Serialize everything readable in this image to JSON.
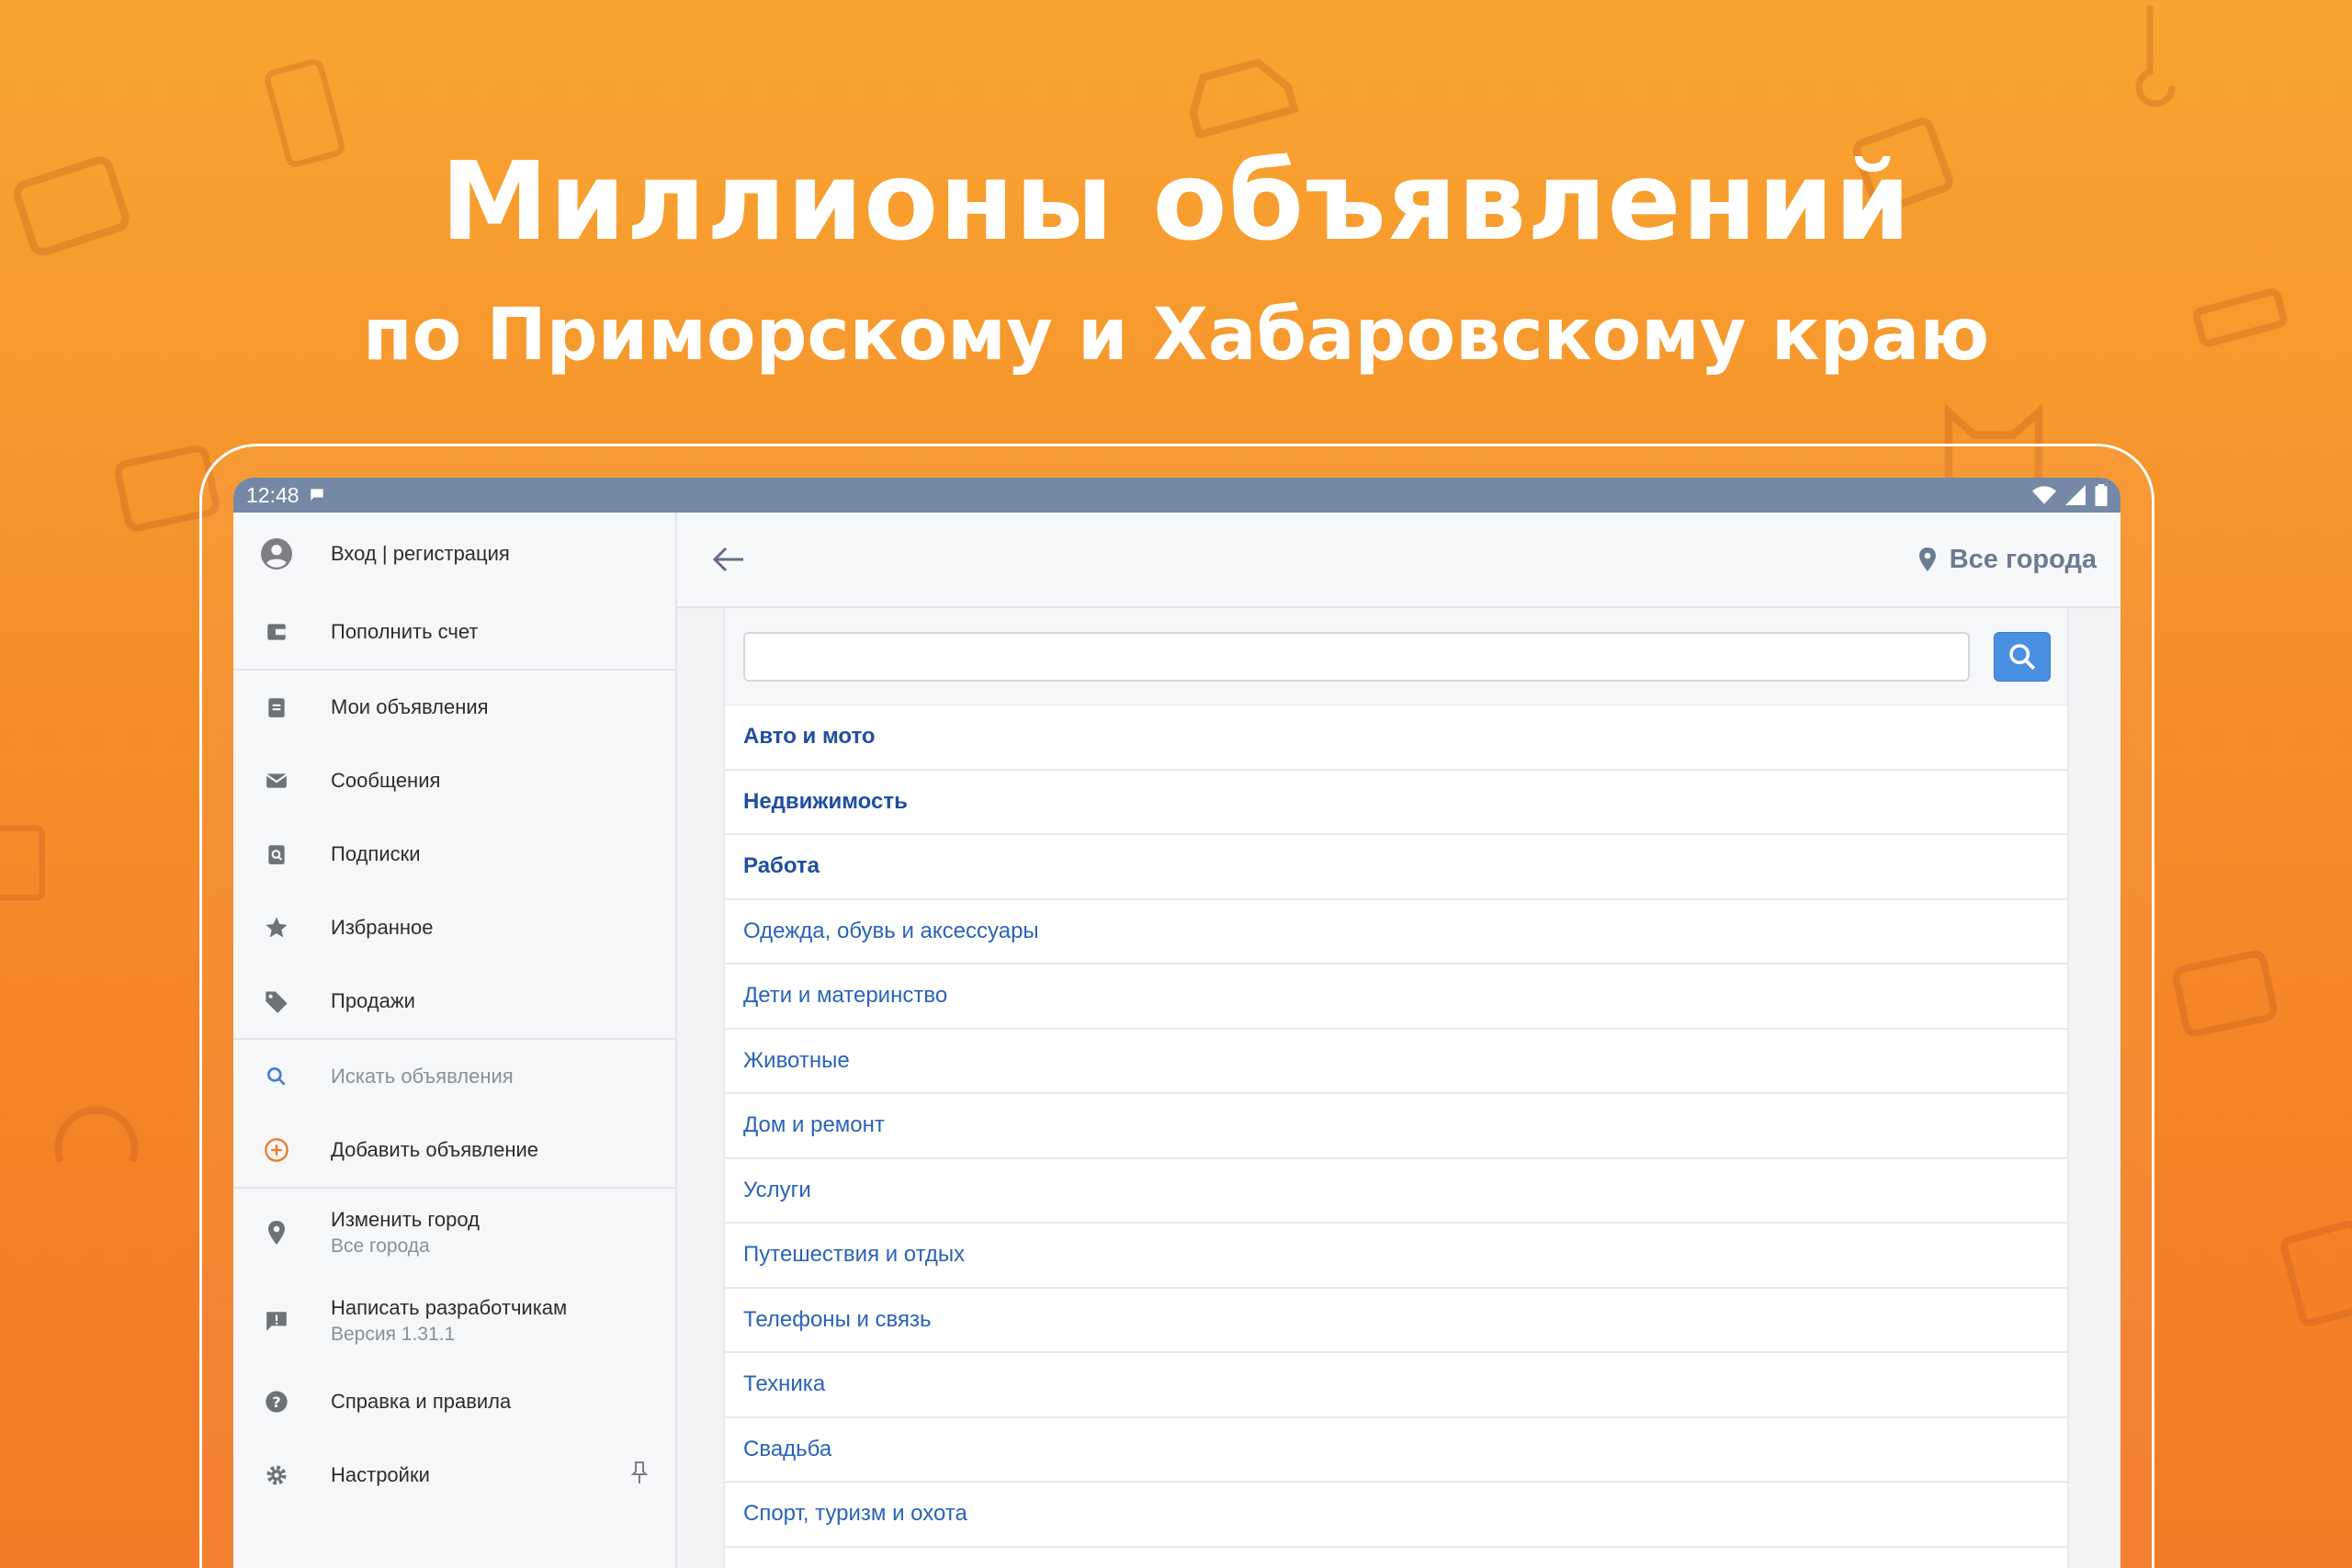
{
  "promo": {
    "headline": "Миллионы объявлений",
    "subheadline": "по Приморскому и Хабаровскому краю"
  },
  "statusbar": {
    "time": "12:48"
  },
  "drawer": {
    "login_label": "Вход | регистрация",
    "topup_label": "Пополнить счет",
    "items": [
      {
        "label": "Мои объявления",
        "icon": "clipboard-icon"
      },
      {
        "label": "Сообщения",
        "icon": "mail-icon"
      },
      {
        "label": "Подписки",
        "icon": "subscription-icon"
      },
      {
        "label": "Избранное",
        "icon": "star-icon"
      },
      {
        "label": "Продажи",
        "icon": "tag-icon"
      }
    ],
    "search_label": "Искать объявления",
    "add_label": "Добавить объявление",
    "change_city_label": "Изменить город",
    "change_city_value": "Все города",
    "write_dev_label": "Написать разработчикам",
    "version": "Версия 1.31.1",
    "help_label": "Справка и правила",
    "settings_label": "Настройки"
  },
  "appbar": {
    "city_label": "Все города"
  },
  "search": {
    "value": "",
    "placeholder": ""
  },
  "categories": [
    {
      "label": "Авто и мото",
      "bold": true
    },
    {
      "label": "Недвижимость",
      "bold": true
    },
    {
      "label": "Работа",
      "bold": true
    },
    {
      "label": "Одежда, обувь и аксессуары",
      "bold": false
    },
    {
      "label": "Дети и материнство",
      "bold": false
    },
    {
      "label": "Животные",
      "bold": false
    },
    {
      "label": "Дом и ремонт",
      "bold": false
    },
    {
      "label": "Услуги",
      "bold": false
    },
    {
      "label": "Путешествия и отдых",
      "bold": false
    },
    {
      "label": "Телефоны и связь",
      "bold": false
    },
    {
      "label": "Техника",
      "bold": false
    },
    {
      "label": "Свадьба",
      "bold": false
    },
    {
      "label": "Спорт, туризм и охота",
      "bold": false
    }
  ],
  "colors": {
    "accent": "#4a90e2",
    "link": "#2a63b8",
    "statusbar": "#7588a5",
    "background": "#f68d2a",
    "add_icon": "#f07b23"
  }
}
